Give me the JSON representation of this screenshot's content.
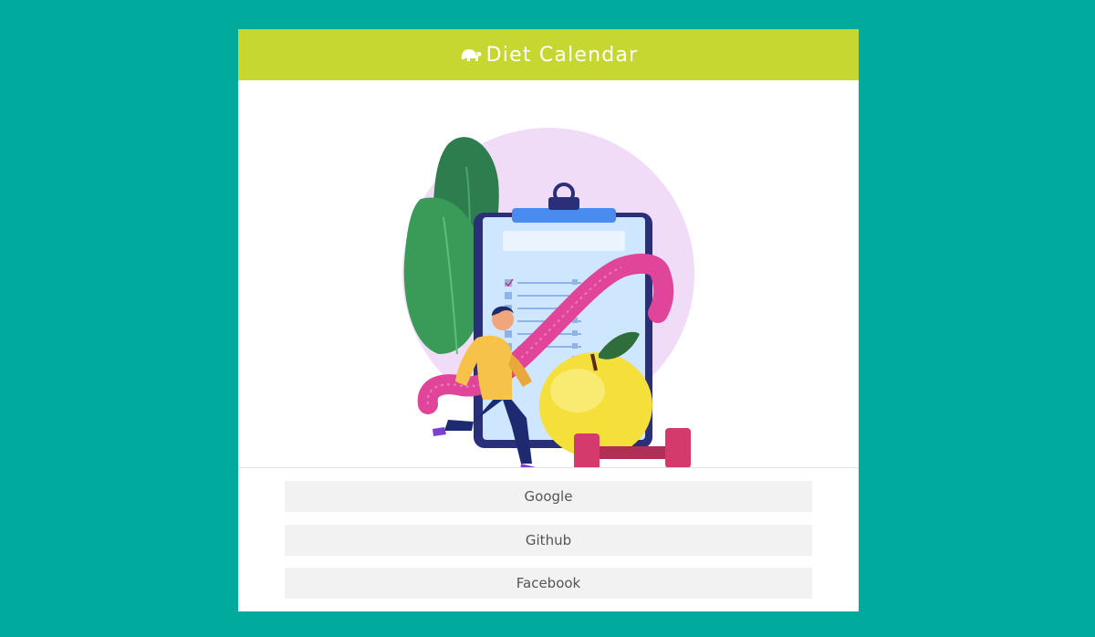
{
  "header": {
    "title": "Diet Calendar",
    "logo_icon": "elephant-icon",
    "background": "#c6d732"
  },
  "page": {
    "background": "#00ab9e"
  },
  "illustration": {
    "icon": "diet-clipboard-illustration"
  },
  "login": {
    "buttons": [
      {
        "label": "Google"
      },
      {
        "label": "Github"
      },
      {
        "label": "Facebook"
      }
    ]
  }
}
